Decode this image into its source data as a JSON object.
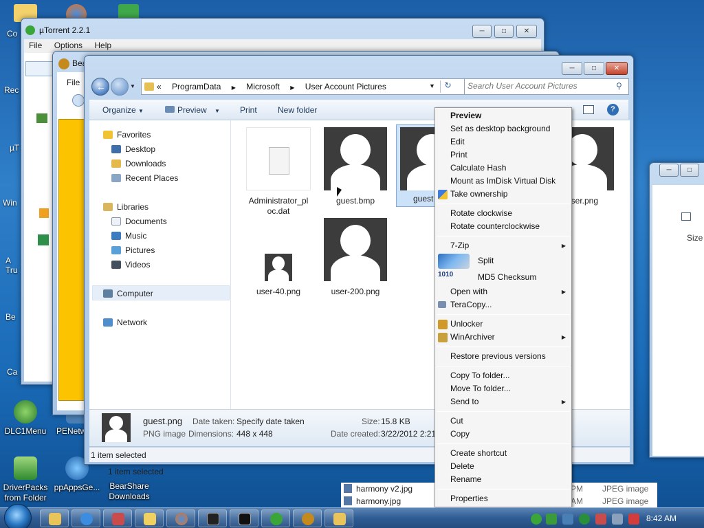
{
  "desktop": {
    "icons": [
      {
        "label": "DLC1Menu"
      },
      {
        "label": "PENetw"
      },
      {
        "label": "DriverPacks from Folder"
      },
      {
        "label": "ppAppsGe..."
      },
      {
        "label": "BearShare Downloads"
      }
    ],
    "cut_labels": [
      "Co",
      "Rec",
      "µT",
      "Win",
      "A Tru",
      "Be",
      "Ca"
    ]
  },
  "utorrent": {
    "title": "µTorrent 2.2.1",
    "menu": [
      "File",
      "Options",
      "Help"
    ]
  },
  "bearshare": {
    "title": "Bea",
    "menu_file": "File",
    "status": "1 item selected"
  },
  "rightwin": {
    "col_size": "Size",
    "files": [
      {
        "name": "harmony v2.jpg",
        "time": "PM",
        "type": "JPEG image"
      },
      {
        "name": "harmony.jpg",
        "time": "AM",
        "type": "JPEG image"
      }
    ]
  },
  "explorer": {
    "breadcrumb": [
      "«",
      "ProgramData",
      "Microsoft",
      "User Account Pictures"
    ],
    "search_placeholder": "Search User Account Pictures",
    "toolbar": {
      "organize": "Organize",
      "preview": "Preview",
      "print": "Print",
      "new_folder": "New folder"
    },
    "nav": {
      "favorites": "Favorites",
      "desktop": "Desktop",
      "downloads": "Downloads",
      "recent": "Recent Places",
      "libraries": "Libraries",
      "documents": "Documents",
      "music": "Music",
      "pictures": "Pictures",
      "videos": "Videos",
      "computer": "Computer",
      "network": "Network"
    },
    "files": {
      "f1": "Administrator_pl oc.dat",
      "f2": "guest.bmp",
      "f3": "guest",
      "f4": "user.png",
      "f5": "user-40.png",
      "f6": "user-200.png"
    },
    "details": {
      "name": "guest.png",
      "type": "PNG image",
      "date_taken_label": "Date taken:",
      "date_taken_value": "Specify date taken",
      "dimensions_label": "Dimensions:",
      "dimensions_value": "448 x 448",
      "size_label": "Size:",
      "size_value": "15.8 KB",
      "created_label": "Date created:",
      "created_value": "3/22/2012 2:21"
    },
    "status": "1 item selected"
  },
  "context_menu": {
    "preview": "Preview",
    "set_bg": "Set as desktop background",
    "edit": "Edit",
    "print": "Print",
    "hash": "Calculate Hash",
    "imdisk": "Mount as ImDisk Virtual Disk",
    "ownership": "Take ownership",
    "rot_cw": "Rotate clockwise",
    "rot_ccw": "Rotate counterclockwise",
    "zip": "7-Zip",
    "split": "Split",
    "md5": "MD5 Checksum",
    "open_with": "Open with",
    "teracopy": "TeraCopy...",
    "unlocker": "Unlocker",
    "winarchiver": "WinArchiver",
    "restore": "Restore previous versions",
    "copy_to": "Copy To folder...",
    "move_to": "Move To folder...",
    "send_to": "Send to",
    "cut": "Cut",
    "copy": "Copy",
    "shortcut": "Create shortcut",
    "delete": "Delete",
    "rename": "Rename",
    "properties": "Properties"
  },
  "taskbar": {
    "clock": "8:42 AM",
    "accent": "#2e5c93"
  }
}
